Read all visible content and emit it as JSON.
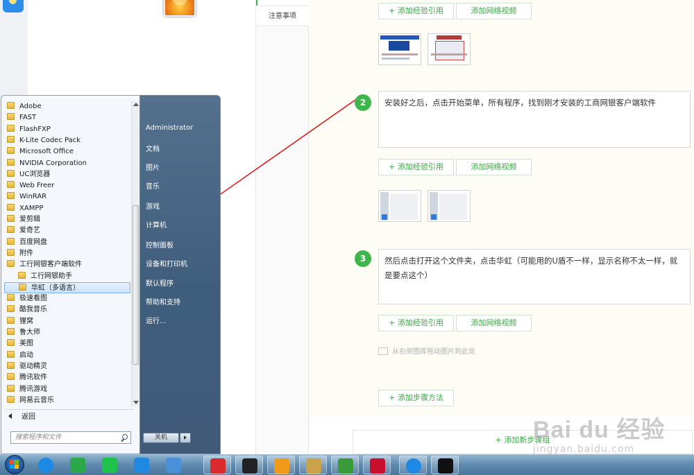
{
  "sidenav": {
    "note": "注意事项"
  },
  "editor": {
    "btn_cite": "+ 添加经验引用",
    "btn_video": "添加网络视频",
    "steps": [
      {
        "num": "2",
        "text": "安装好之后，点击开始菜单，所有程序，找到刚才安装的工商网银客户端软件"
      },
      {
        "num": "3",
        "text": "然后点击打开这个文件夹，点击华虹（可能用的U盾不一样，显示名称不太一样，就是要点这个）"
      }
    ],
    "image_hint": "从右侧图库拖动图片到此处",
    "add_step_method": "+ 添加步骤方法",
    "add_steps_group": "+ 添加新步骤组"
  },
  "watermark": {
    "main": "Bai du 经验",
    "sub": "jingyan.baidu.com"
  },
  "startmenu": {
    "programs": [
      {
        "label": "Adobe",
        "level": 0
      },
      {
        "label": "FAST",
        "level": 0
      },
      {
        "label": "FlashFXP",
        "level": 0
      },
      {
        "label": "K-Lite Codec Pack",
        "level": 0
      },
      {
        "label": "Microsoft Office",
        "level": 0
      },
      {
        "label": "NVIDIA Corporation",
        "level": 0
      },
      {
        "label": "UC浏览器",
        "level": 0
      },
      {
        "label": "Web Freer",
        "level": 0
      },
      {
        "label": "WinRAR",
        "level": 0
      },
      {
        "label": "XAMPP",
        "level": 0
      },
      {
        "label": "爱剪辑",
        "level": 0
      },
      {
        "label": "爱奇艺",
        "level": 0
      },
      {
        "label": "百度网盘",
        "level": 0
      },
      {
        "label": "附件",
        "level": 0
      },
      {
        "label": "工行网银客户端软件",
        "level": 0
      },
      {
        "label": "工行网银助手",
        "level": 1
      },
      {
        "label": "华虹（多语言）",
        "level": 1,
        "selected": true
      },
      {
        "label": "极速看图",
        "level": 0
      },
      {
        "label": "酷我音乐",
        "level": 0
      },
      {
        "label": "狸窝",
        "level": 0
      },
      {
        "label": "鲁大师",
        "level": 0
      },
      {
        "label": "美图",
        "level": 0
      },
      {
        "label": "启动",
        "level": 0
      },
      {
        "label": "驱动精灵",
        "level": 0
      },
      {
        "label": "腾讯软件",
        "level": 0
      },
      {
        "label": "腾讯游戏",
        "level": 0
      },
      {
        "label": "网易云音乐",
        "level": 0
      }
    ],
    "back": "返回",
    "search_placeholder": "搜索程序和文件",
    "right": {
      "user": "Administrator",
      "documents": "文档",
      "pictures": "图片",
      "music": "音乐",
      "games": "游戏",
      "computer": "计算机",
      "control_panel": "控制面板",
      "devices_printers": "设备和打印机",
      "default_programs": "默认程序",
      "help_support": "帮助和支持",
      "run": "运行..."
    },
    "shutdown": "关机"
  },
  "taskbar": {
    "icons": [
      "ie-icon",
      "media-player-icon",
      "iqiyi-icon",
      "swallow-icon",
      "baidu-netdisk-icon",
      "netease-music-icon",
      "g-app-icon",
      "uc-browser-icon",
      "explorer-icon",
      "app-store-icon",
      "icbc-icon",
      "ie-icon",
      "qq-icon"
    ]
  },
  "colors": {
    "accent_green": "#3fb64b",
    "arrow_red": "#e02020",
    "taskbar_blue": "#5d89ad"
  }
}
